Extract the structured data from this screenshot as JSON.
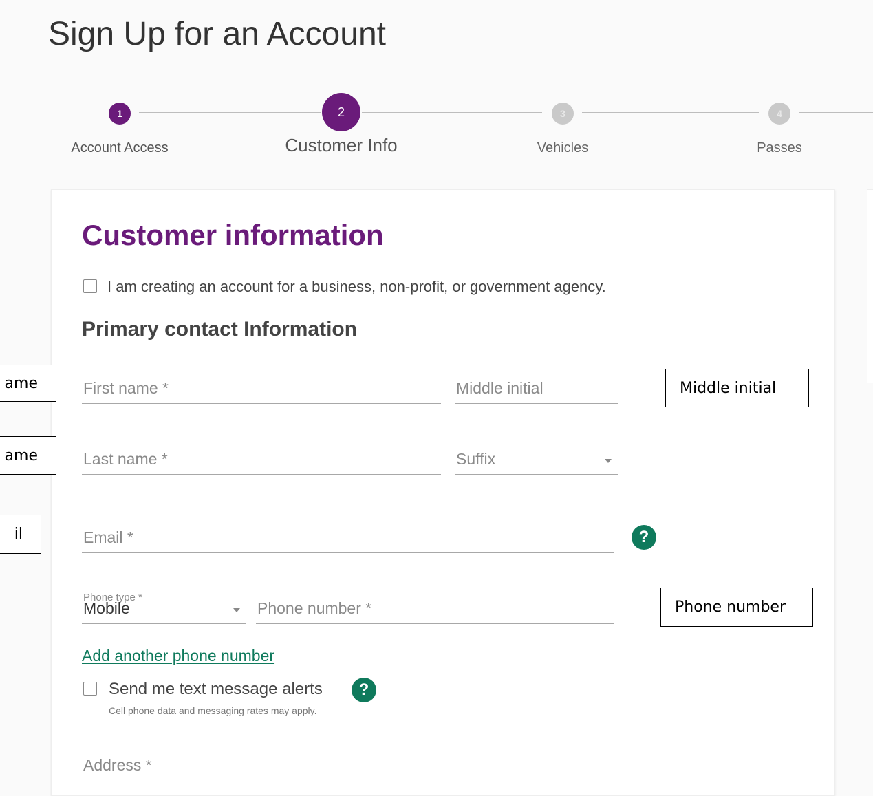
{
  "page": {
    "title": "Sign Up for an Account"
  },
  "stepper": {
    "steps": [
      {
        "number": "1",
        "label": "Account Access",
        "state": "completed"
      },
      {
        "number": "2",
        "label": "Customer Info",
        "state": "current"
      },
      {
        "number": "3",
        "label": "Vehicles",
        "state": "upcoming"
      },
      {
        "number": "4",
        "label": "Passes",
        "state": "upcoming"
      }
    ]
  },
  "form": {
    "heading": "Customer information",
    "business_checkbox_label": "I am creating an account for a business, non-profit, or government agency.",
    "business_checkbox_checked": false,
    "primary_contact_heading": "Primary contact Information",
    "first_name_placeholder": "First name *",
    "middle_initial_placeholder": "Middle initial",
    "last_name_placeholder": "Last name *",
    "suffix_placeholder": "Suffix",
    "email_placeholder": "Email *",
    "phone_type_label": "Phone type *",
    "phone_type_value": "Mobile",
    "phone_number_placeholder": "Phone number *",
    "add_phone_link": "Add another phone number",
    "text_alerts_label": "Send me text message alerts",
    "text_alerts_checked": false,
    "text_alerts_note": "Cell phone data and messaging rates may apply.",
    "address_placeholder": "Address *",
    "help_icon_glyph": "?"
  },
  "annotations": {
    "first_name": "ame",
    "last_name": "ame",
    "email": "il",
    "middle_initial": "Middle initial",
    "phone_number": "Phone number"
  },
  "colors": {
    "accent_purple": "#6a1b7a",
    "help_green": "#0f7a5c",
    "inactive_step": "#c9c9c9"
  }
}
